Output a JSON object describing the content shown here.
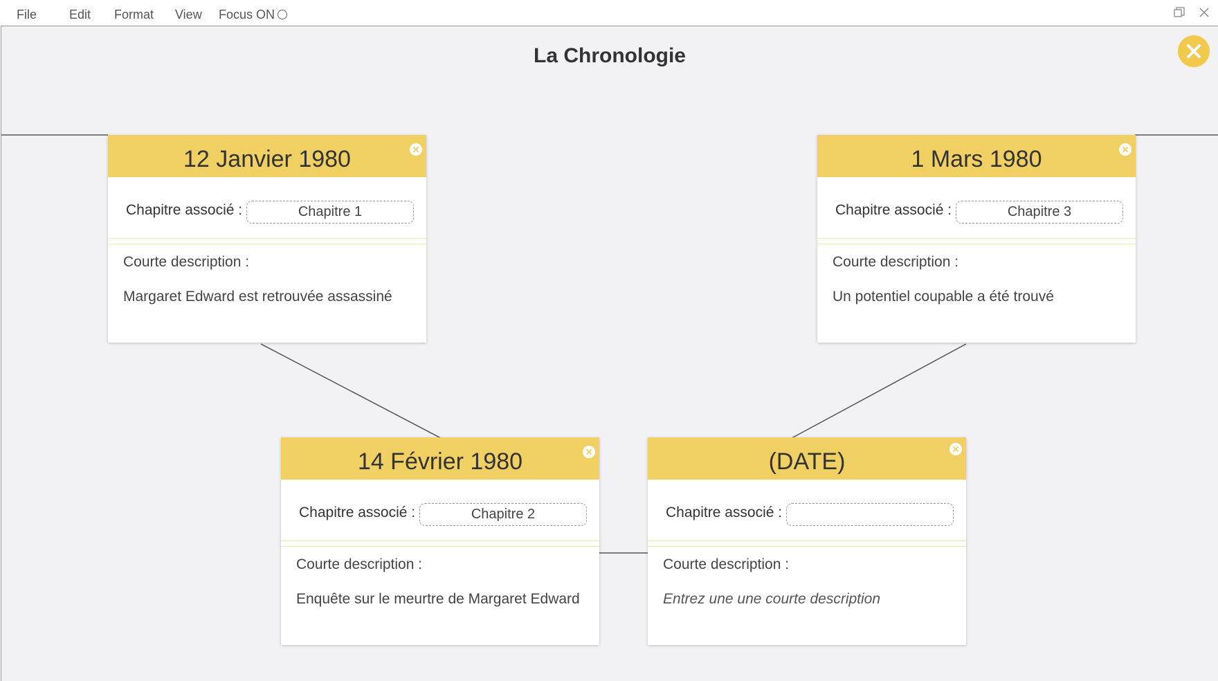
{
  "menu": {
    "file": "File",
    "edit": "Edit",
    "format": "Format",
    "view": "View",
    "focus": "Focus ON"
  },
  "page": {
    "title": "La Chronologie"
  },
  "labels": {
    "chapter": "Chapitre associé :",
    "description": "Courte description :"
  },
  "cards": [
    {
      "date": "12 Janvier 1980",
      "chapter": "Chapitre 1",
      "description": "Margaret Edward est retrouvée assassiné"
    },
    {
      "date": "1 Mars 1980",
      "chapter": "Chapitre 3",
      "description": "Un potentiel coupable a été trouvé"
    },
    {
      "date": "14 Février 1980",
      "chapter": "Chapitre 2",
      "description": "Enquête sur le meurtre de Margaret Edward"
    },
    {
      "date": "(DATE)",
      "chapter": "",
      "description": "",
      "description_placeholder": "Entrez une une courte description"
    }
  ],
  "colors": {
    "accent": "#f0cf63",
    "background": "#f2f2f4",
    "card": "#ffffff"
  },
  "icons": {
    "close_main": "close-x-circle-icon",
    "card_close": "close-x-circle-icon",
    "restore": "restore-window-icon",
    "window_close": "close-window-icon"
  }
}
